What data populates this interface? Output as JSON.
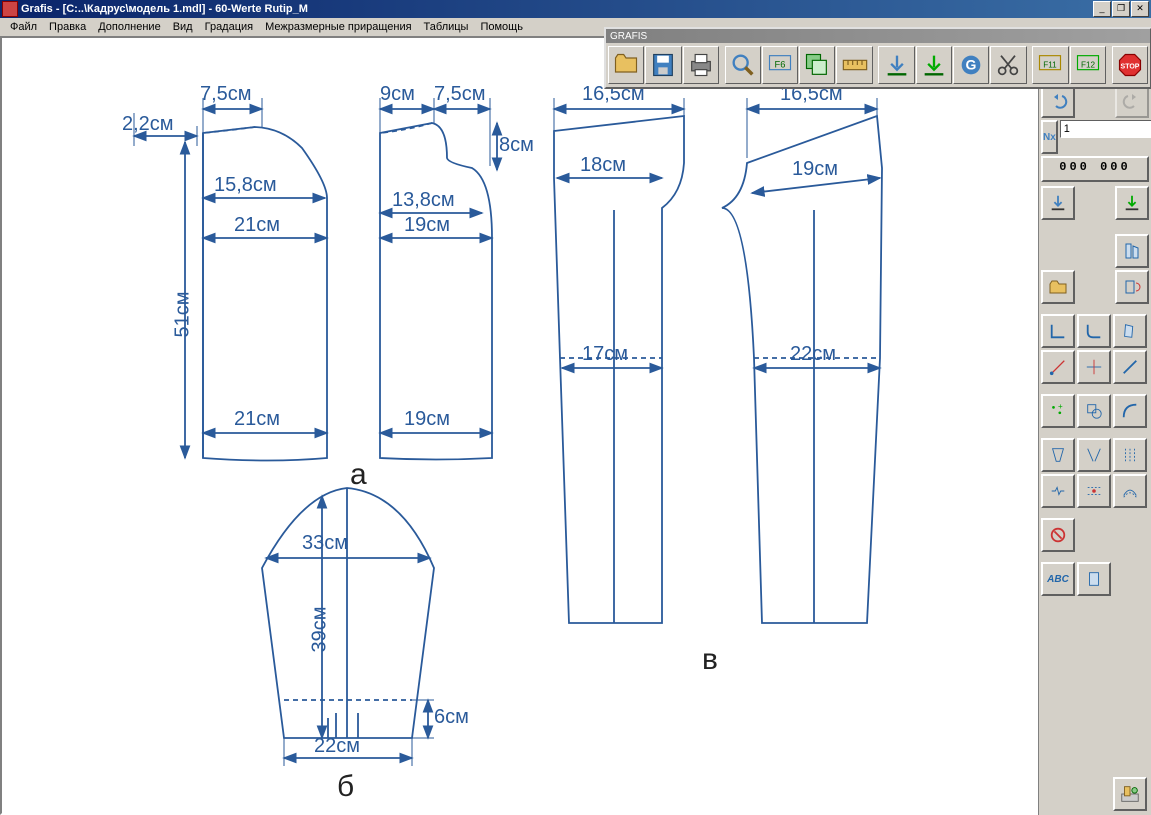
{
  "title": "Grafis - [C:..\\Кадрус\\модель 1.mdl] - 60-Werte Rutip_M",
  "floatbar_title": "GRAFIS",
  "menu": {
    "m0": "Файл",
    "m1": "Правка",
    "m2": "Дополнение",
    "m3": "Вид",
    "m4": "Градация",
    "m5": "Межразмерные приращения",
    "m6": "Таблицы",
    "m7": "Помощь"
  },
  "right": {
    "nx_value": "1",
    "counter": "000 000"
  },
  "dims": {
    "d1": "7,5см",
    "d2": "2,2см",
    "d3": "15,8см",
    "d4": "21см",
    "d5": "51см",
    "d6": "21см",
    "d7": "9см",
    "d8": "7,5см",
    "d9": "8см",
    "d10": "13,8см",
    "d11": "19см",
    "d12": "19см",
    "d13": "16,5см",
    "d14": "18см",
    "d15": "17см",
    "d16": "16,5см",
    "d17": "19см",
    "d18": "22см",
    "d19": "33см",
    "d20": "39см",
    "d21": "22см",
    "d22": "6см"
  },
  "figs": {
    "a": "а",
    "b": "б",
    "v": "в"
  }
}
